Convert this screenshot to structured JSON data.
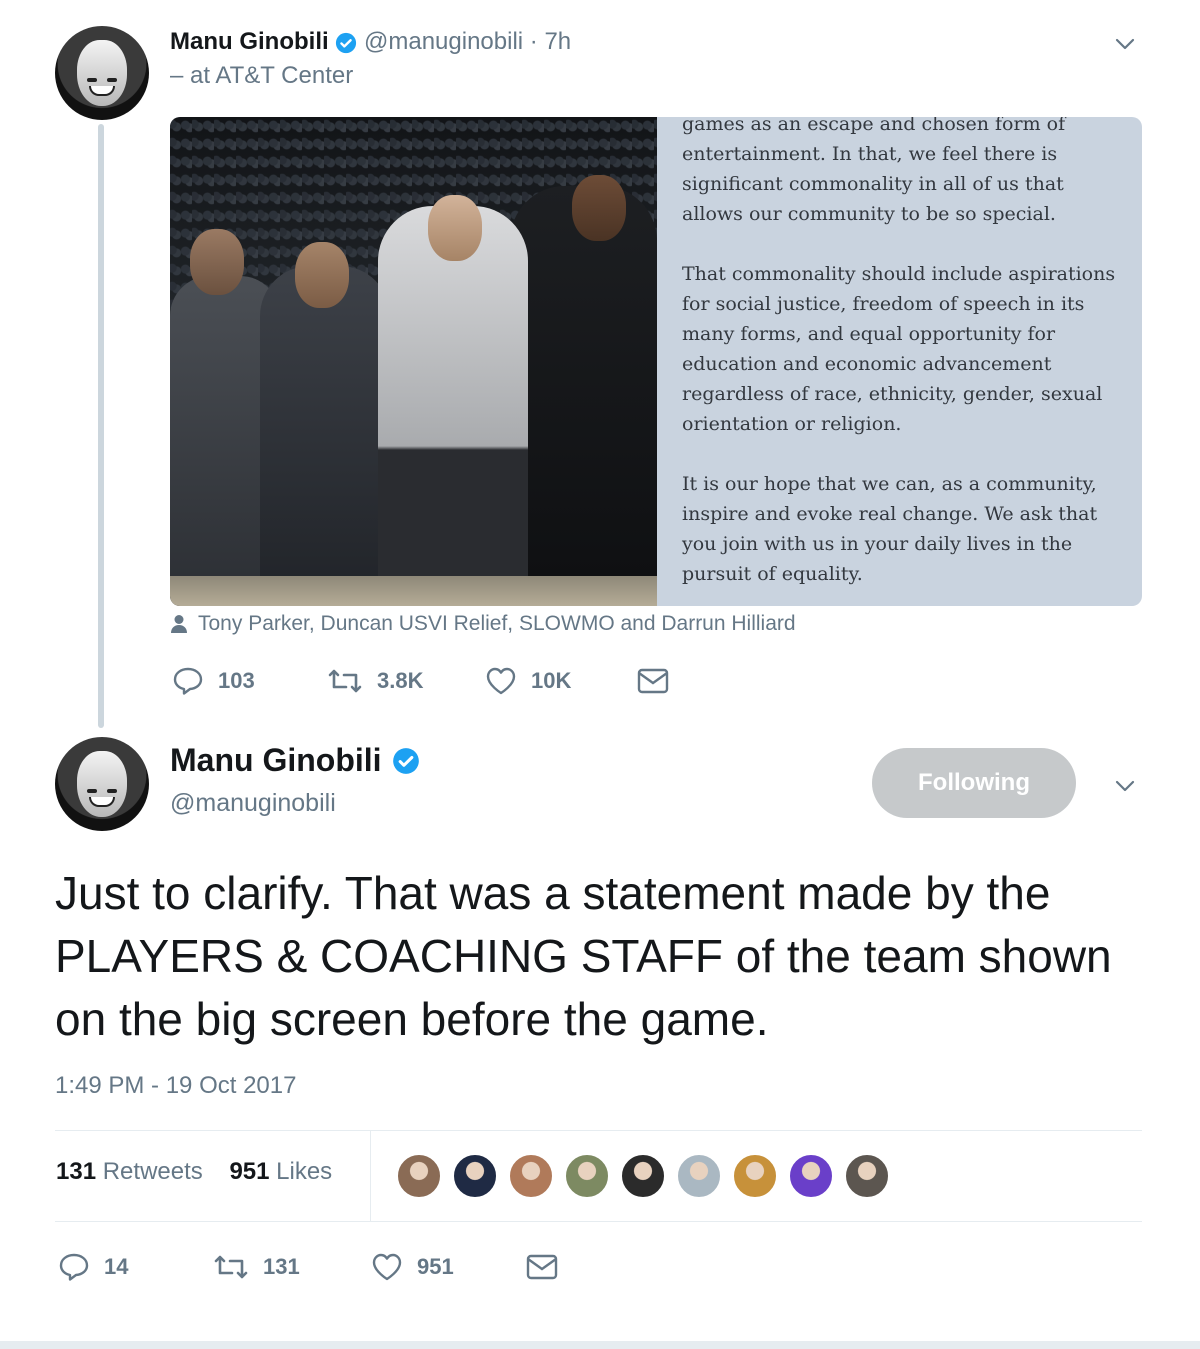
{
  "tweet1": {
    "name": "Manu Ginobili",
    "handle_time": "@manuginobili · 7h",
    "location": "– at AT&T Center",
    "statement": [
      "games as an escape and chosen form of entertainment. In that, we feel there is significant commonality in all of us that allows our community to be so special.",
      "That commonality should include aspirations for social justice, freedom of speech in its many forms, and equal opportunity for education and economic advancement regardless of race, ethnicity, gender, sexual orientation or religion.",
      "It is our hope that we can, as a community, inspire and evoke real change. We ask that you join with us in your daily lives in the pursuit of equality."
    ],
    "tagged": "Tony Parker, Duncan USVI Relief, SLOWMO and Darrun Hilliard",
    "replies": "103",
    "retweets": "3.8K",
    "likes": "10K"
  },
  "tweet2": {
    "name": "Manu Ginobili",
    "handle": "@manuginobili",
    "follow_label": "Following",
    "text": "Just to clarify. That was a statement made by the PLAYERS & COACHING STAFF of the team shown on the big screen before the game.",
    "timestamp": "1:49 PM - 19 Oct 2017",
    "retweet_count": "131",
    "retweet_label": "Retweets",
    "like_count": "951",
    "like_label": "Likes",
    "replies": "14",
    "retweets": "131",
    "likes": "951"
  },
  "colors": {
    "text": "#14171a",
    "muted": "#657786",
    "verified": "#1da1f2",
    "button_disabled": "#c6c9cb",
    "divider": "#e6ecf0"
  },
  "likers": [
    {
      "color": "#8a6b55"
    },
    {
      "color": "#1f2a44"
    },
    {
      "color": "#b07a5a"
    },
    {
      "color": "#7d8a62"
    },
    {
      "color": "#2b2b2b"
    },
    {
      "color": "#aab8c2"
    },
    {
      "color": "#c7913a"
    },
    {
      "color": "#6a3fc9"
    },
    {
      "color": "#5c5650"
    }
  ]
}
